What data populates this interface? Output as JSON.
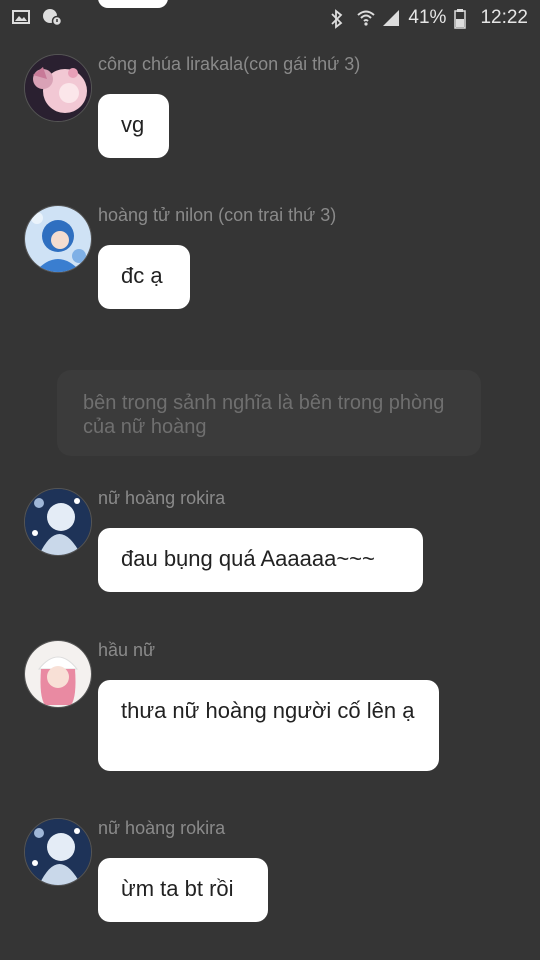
{
  "status_bar": {
    "battery": "41%",
    "time": "12:22",
    "icons": [
      "image-icon",
      "chat-notification-icon",
      "bluetooth-icon",
      "wifi-icon",
      "signal-icon",
      "battery-icon"
    ]
  },
  "messages": [
    {
      "sender": "công chúa lirakala(con gái thứ 3)",
      "text": "vg",
      "avatar": "pink-anime-girl-avatar"
    },
    {
      "sender": "hoàng tử nilon  (con trai thứ 3)",
      "text": "đc ạ",
      "avatar": "blue-anime-boy-avatar"
    },
    {
      "sender": "nữ hoàng rokira",
      "text": "đau bụng quá Aaaaaa~~~",
      "avatar": "white-hair-queen-avatar"
    },
    {
      "sender": "hầu nữ",
      "text": "thưa nữ hoàng người cố lên ạ",
      "avatar": "pink-hair-maid-avatar"
    },
    {
      "sender": "nữ hoàng rokira",
      "text": "ừm ta bt rồi",
      "avatar": "white-hair-queen-avatar"
    }
  ],
  "system_message": {
    "text": "bên trong sảnh nghĩa là bên trong phòng của nữ hoàng"
  },
  "colors": {
    "background": "#353535",
    "bubble": "#ffffff",
    "sender_text": "#8a8a8a",
    "system_bubble": "#3b3b3b"
  }
}
